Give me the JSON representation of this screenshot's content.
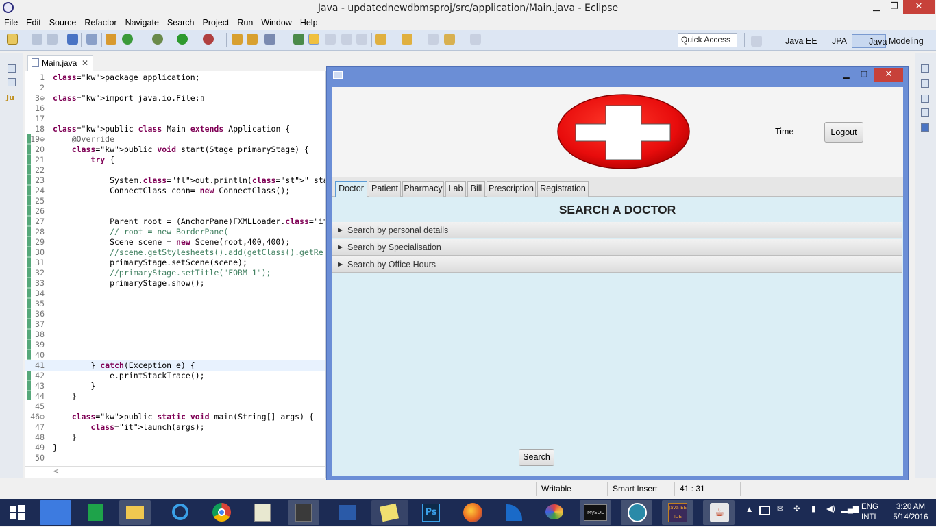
{
  "window": {
    "title": "Java - updatednewdbmsproj/src/application/Main.java - Eclipse",
    "min": "▁",
    "max": "❐",
    "close": "✕"
  },
  "menu": [
    "File",
    "Edit",
    "Source",
    "Refactor",
    "Navigate",
    "Search",
    "Project",
    "Run",
    "Window",
    "Help"
  ],
  "toolbar": {
    "quick_access": "Quick Access",
    "perspectives": [
      "Java EE",
      "JPA",
      "Java",
      "Modeling"
    ]
  },
  "editor": {
    "tab_label": "Main.java",
    "tab_close": "✕",
    "scroll_hint": "<",
    "lines": [
      {
        "n": "1",
        "t": "package application;"
      },
      {
        "n": "2",
        "t": ""
      },
      {
        "n": "3⊕",
        "t": "import java.io.File;▯"
      },
      {
        "n": "16",
        "t": ""
      },
      {
        "n": "17",
        "t": ""
      },
      {
        "n": "18",
        "t": "public class Main extends Application {"
      },
      {
        "n": "19⊖",
        "t": "    @Override"
      },
      {
        "n": "20",
        "t": "    public void start(Stage primaryStage) {"
      },
      {
        "n": "21",
        "t": "        try {"
      },
      {
        "n": "22",
        "t": ""
      },
      {
        "n": "23",
        "t": "            System.out.println(\" started  \");"
      },
      {
        "n": "24",
        "t": "            ConnectClass conn= new ConnectClass();"
      },
      {
        "n": "25",
        "t": ""
      },
      {
        "n": "26",
        "t": ""
      },
      {
        "n": "27",
        "t": "            Parent root = (AnchorPane)FXMLLoader.load(Mai"
      },
      {
        "n": "28",
        "t": "            // root = new BorderPane("
      },
      {
        "n": "29",
        "t": "            Scene scene = new Scene(root,400,400);"
      },
      {
        "n": "30",
        "t": "            //scene.getStylesheets().add(getClass().getRe"
      },
      {
        "n": "31",
        "t": "            primaryStage.setScene(scene);"
      },
      {
        "n": "32",
        "t": "            //primaryStage.setTitle(\"FORM 1\");"
      },
      {
        "n": "33",
        "t": "            primaryStage.show();"
      },
      {
        "n": "34",
        "t": ""
      },
      {
        "n": "35",
        "t": ""
      },
      {
        "n": "36",
        "t": ""
      },
      {
        "n": "37",
        "t": ""
      },
      {
        "n": "38",
        "t": ""
      },
      {
        "n": "39",
        "t": ""
      },
      {
        "n": "40",
        "t": ""
      },
      {
        "n": "41",
        "t": "        } catch(Exception e) {"
      },
      {
        "n": "42",
        "t": "            e.printStackTrace();"
      },
      {
        "n": "43",
        "t": "        }"
      },
      {
        "n": "44",
        "t": "    }"
      },
      {
        "n": "45",
        "t": ""
      },
      {
        "n": "46⊖",
        "t": "    public static void main(String[] args) {"
      },
      {
        "n": "47",
        "t": "        launch(args);"
      },
      {
        "n": "48",
        "t": "    }"
      },
      {
        "n": "49",
        "t": "}"
      },
      {
        "n": "50",
        "t": ""
      }
    ]
  },
  "fx_app": {
    "controls": {
      "min": "▁",
      "max": "□",
      "close": "✕"
    },
    "time_label": "Time",
    "logout_label": "Logout",
    "tabs": [
      "Doctor",
      "Patient",
      "Pharmacy",
      "Lab",
      "Bill",
      "Prescription",
      "Registration"
    ],
    "selected_tab": "Doctor",
    "section_title": "SEARCH A DOCTOR",
    "accordion": [
      "Search by personal details",
      "Search by Specialisation",
      "Search by Office Hours"
    ],
    "search_label": "Search"
  },
  "status": {
    "writable": "Writable",
    "insert": "Smart Insert",
    "position": "41 : 31"
  },
  "taskbar": {
    "apps": [
      "start",
      "google-search",
      "store",
      "file-explorer",
      "internet-explorer",
      "chrome",
      "editor",
      "sublime",
      "powershell",
      "sticky-notes",
      "photoshop",
      "firefox",
      "wireshark",
      "paint",
      "mysql",
      "tool",
      "java-ee-ide",
      "java"
    ],
    "lang": "ENG",
    "layout": "INTL",
    "time": "3:20 AM",
    "date": "5/14/2016"
  },
  "colors": {
    "fx_frame": "#6b8ed6",
    "fx_content": "#dbeef5",
    "close_red": "#c7413a",
    "taskbar": "#1c2b54"
  }
}
